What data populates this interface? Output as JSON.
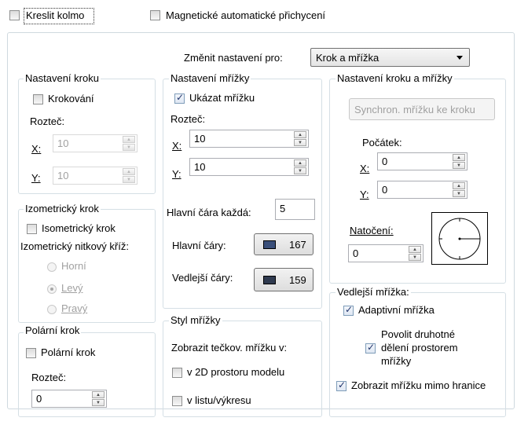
{
  "top": {
    "snap_ortho": "Kreslit kolmo",
    "magnetic_snap": "Magnetické automatické přichycení"
  },
  "change_settings": {
    "label": "Změnit nastavení pro:",
    "value": "Krok a mřížka"
  },
  "step_settings": {
    "title": "Nastavení kroku",
    "enable": "Krokování",
    "spacing_label": "Rozteč:",
    "x_label": "X:",
    "x_value": "10",
    "y_label": "Y:",
    "y_value": "10"
  },
  "isometric": {
    "title": "Izometrický krok",
    "enable": "Isometrický krok",
    "crosshair_label": "Izometrický nitkový kříž:",
    "options": [
      "Horní",
      "Levý",
      "Pravý"
    ],
    "selected": "Levý"
  },
  "polar": {
    "title": "Polární krok",
    "enable": "Polární krok",
    "spacing_label": "Rozteč:",
    "value": "0"
  },
  "grid_settings": {
    "title": "Nastavení mřížky",
    "show_grid": "Ukázat mřížku",
    "spacing_label": "Rozteč:",
    "x_label": "X:",
    "x_value": "10",
    "y_label": "Y:",
    "y_value": "10",
    "major_every_label": "Hlavní čára každá:",
    "major_every_value": "5",
    "major_lines_label": "Hlavní čáry:",
    "major_lines_value": "167",
    "major_lines_color": "#3a4f7a",
    "minor_lines_label": "Vedlejší čáry:",
    "minor_lines_value": "159",
    "minor_lines_color": "#2f3a4f"
  },
  "grid_style": {
    "title": "Styl mřížky",
    "dotted_label": "Zobrazit tečkov. mřížku v:",
    "model_space": "v 2D prostoru modelu",
    "paper_space": "v listu/výkresu"
  },
  "step_grid": {
    "title": "Nastavení kroku a mřížky",
    "sync_button": "Synchron. mřížku ke kroku",
    "origin_label": "Počátek:",
    "x_label": "X:",
    "x_value": "0",
    "y_label": "Y:",
    "y_value": "0",
    "rotation_label": "Natočení:",
    "rotation_value": "0"
  },
  "subgrid": {
    "title": "Vedlejší mřížka:",
    "adaptive": "Adaptivní mřížka",
    "allow_sub_line1": "Povolit druhotné",
    "allow_sub_line2": "dělení prostorem",
    "allow_sub_line3": "mřížky",
    "beyond_limits": "Zobrazit mřížku mimo hranice"
  }
}
